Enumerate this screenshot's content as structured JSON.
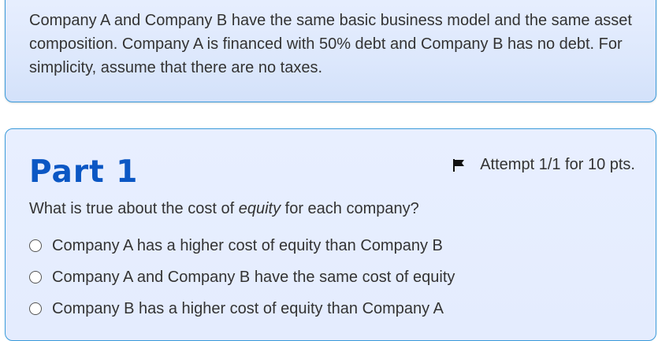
{
  "intro": {
    "text": "Company A and Company B have the same basic business model and the same asset composition. Company A is financed with 50% debt and Company B has no debt. For simplicity, assume that there are no taxes."
  },
  "part": {
    "title": "Part 1",
    "attempt": "Attempt 1/1 for 10 pts.",
    "flag_icon": "flag-icon",
    "question_before": "What is true about the cost of ",
    "question_emphasis": "equity",
    "question_after": " for each company?",
    "options": [
      {
        "label": "Company A has a higher cost of equity than Company B"
      },
      {
        "label": "Company A and Company B have the same cost of equity"
      },
      {
        "label": "Company B has a higher cost of equity than Company A"
      }
    ]
  },
  "colors": {
    "accent": "#0b57c4",
    "card_border": "#3a9ad9",
    "card_bg": "#e4ecfe"
  }
}
